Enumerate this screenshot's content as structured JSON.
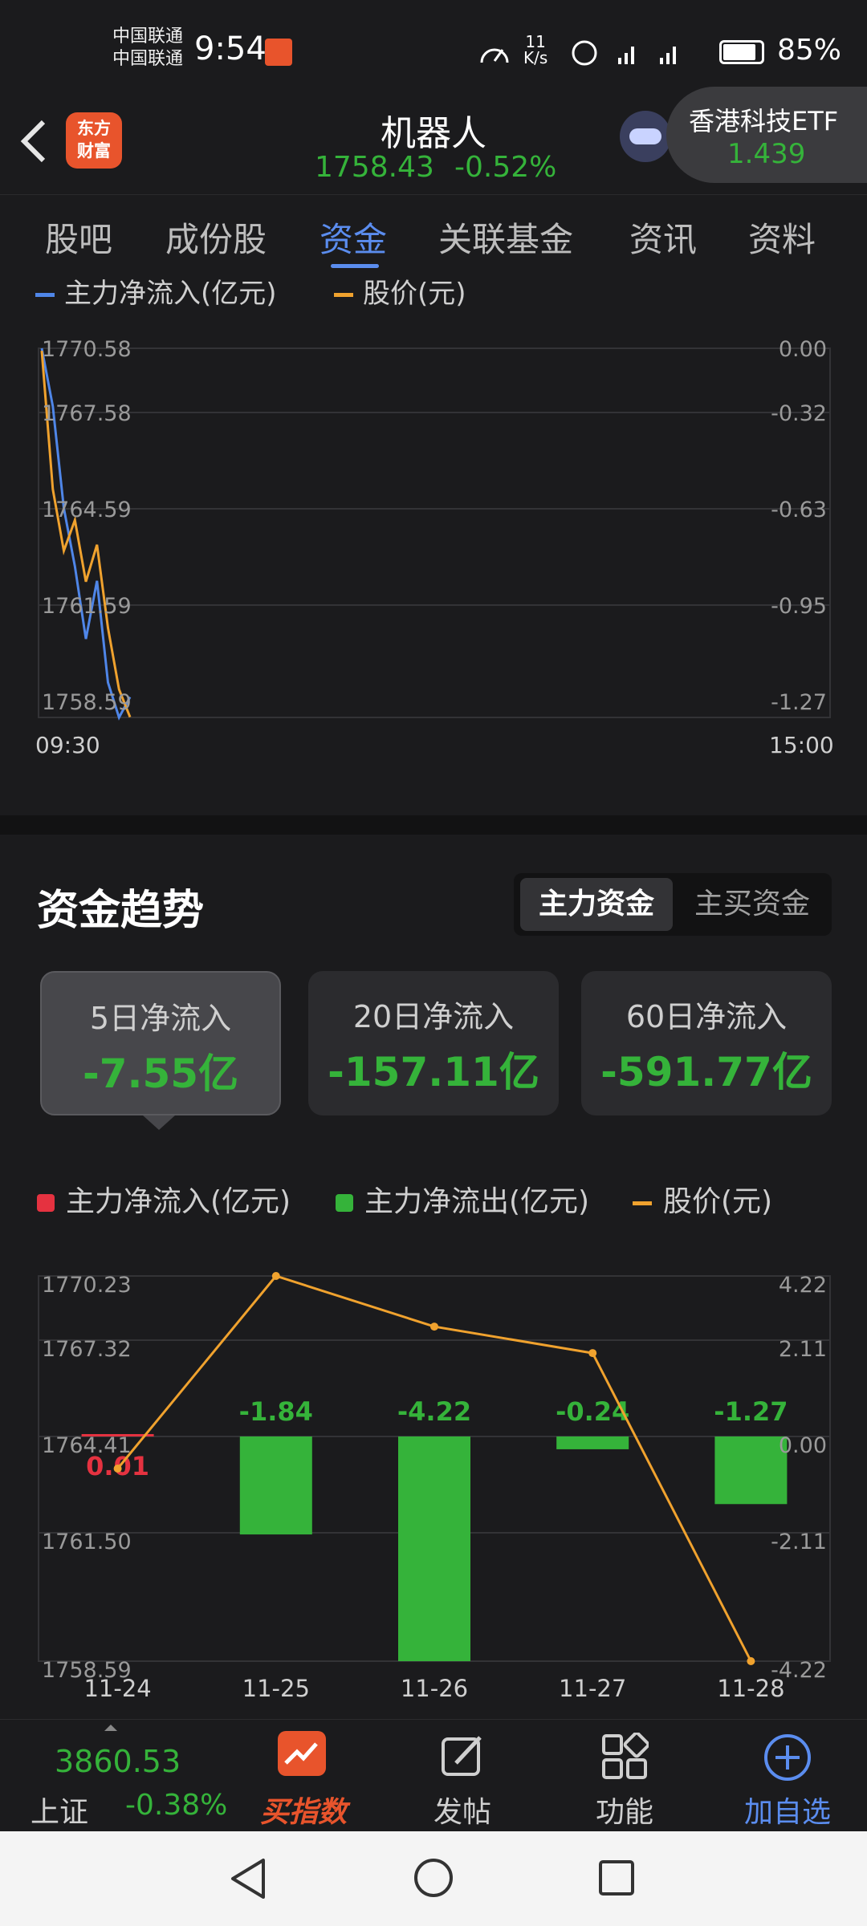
{
  "status_bar": {
    "carrier1": "中国联通",
    "carrier2": "中国联通",
    "time": "9:54",
    "net_speed_value": "11",
    "net_speed_unit": "K/s",
    "battery": "85%"
  },
  "header": {
    "brand_line1": "东方",
    "brand_line2": "财富",
    "title": "机器人",
    "price": "1758.43",
    "change": "-0.52%",
    "popup_name": "香港科技ETF",
    "popup_price": "1.439"
  },
  "tabs": [
    "股吧",
    "成份股",
    "资金",
    "关联基金",
    "资讯",
    "资料"
  ],
  "active_tab": 2,
  "intraday": {
    "legend_flow": "主力净流入(亿元)",
    "legend_price": "股价(元)",
    "left_ticks": [
      "1770.58",
      "1767.58",
      "1764.59",
      "1761.59",
      "1758.59"
    ],
    "right_ticks": [
      "0.00",
      "-0.32",
      "-0.63",
      "-0.95",
      "-1.27"
    ],
    "x_start": "09:30",
    "x_end": "15:00"
  },
  "trend": {
    "title": "资金趋势",
    "toggle_main": "主力资金",
    "toggle_buy": "主买资金",
    "cards": [
      {
        "label": "5日净流入",
        "value": "-7.55亿"
      },
      {
        "label": "20日净流入",
        "value": "-157.11亿"
      },
      {
        "label": "60日净流入",
        "value": "-591.77亿"
      }
    ],
    "legend": {
      "inflow": "主力净流入(亿元)",
      "outflow": "主力净流出(亿元)",
      "price": "股价(元)"
    }
  },
  "chart_data": [
    {
      "type": "line",
      "title": "",
      "series": [
        {
          "name": "主力净流入(亿元)",
          "axis": "right",
          "color": "#4f86e8",
          "values": [
            0.0,
            -0.2,
            -0.55,
            -0.75,
            -1.0,
            -0.8,
            -1.15,
            -1.27,
            -1.2
          ]
        },
        {
          "name": "股价(元)",
          "axis": "left",
          "color": "#f0a22e",
          "values": [
            1770.5,
            1766.0,
            1764.0,
            1765.0,
            1763.0,
            1764.2,
            1761.5,
            1759.5,
            1758.6
          ]
        }
      ],
      "left_ylim": [
        1758.59,
        1770.58
      ],
      "right_ylim": [
        -1.27,
        0.0
      ],
      "x_range": [
        "09:30",
        "15:00"
      ],
      "grid": true
    },
    {
      "type": "bar",
      "categories": [
        "11-24",
        "11-25",
        "11-26",
        "11-27",
        "11-28"
      ],
      "series": [
        {
          "name": "主力净流入(亿元)",
          "axis": "right",
          "color": "#e53240",
          "values": [
            0.01,
            -1.84,
            -4.22,
            -0.24,
            -1.27
          ]
        },
        {
          "name": "股价(元)",
          "axis": "left",
          "color": "#f0a22e",
          "values": [
            1764.41,
            1770.23,
            1768.7,
            1767.9,
            1758.59
          ]
        }
      ],
      "bar_labels": [
        "0.01",
        "-1.84",
        "-4.22",
        "-0.24",
        "-1.27"
      ],
      "left_ticks": [
        "1770.23",
        "1767.32",
        "1764.41",
        "1761.50",
        "1758.59"
      ],
      "right_ticks": [
        "4.22",
        "2.11",
        "0.00",
        "-2.11",
        "-4.22"
      ],
      "left_ylim": [
        1758.59,
        1770.23
      ],
      "right_ylim": [
        -4.22,
        4.22
      ],
      "grid": true
    }
  ],
  "bottom_nav": {
    "index_value": "3860.53",
    "index_name": "上证",
    "index_change": "-0.38%",
    "buy_index": "买指数",
    "post": "发帖",
    "functions": "功能",
    "add_watch": "加自选"
  },
  "colors": {
    "up": "#e53240",
    "down": "#35b33a",
    "accent": "#5b8def",
    "price_line": "#f0a22e",
    "flow_line": "#4f86e8"
  }
}
